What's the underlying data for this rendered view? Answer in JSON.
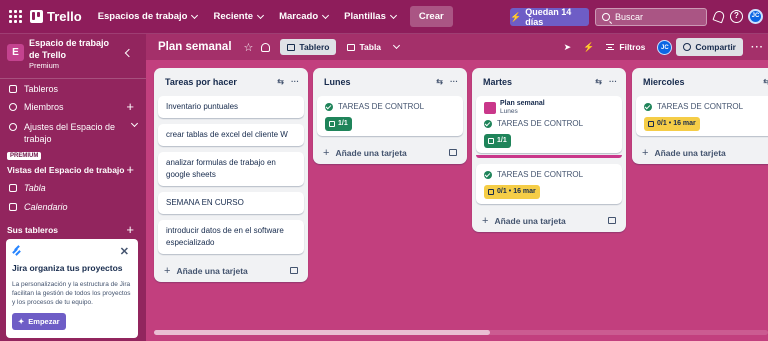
{
  "topbar": {
    "app_name": "Trello",
    "nav": [
      "Espacios de trabajo",
      "Reciente",
      "Marcado",
      "Plantillas"
    ],
    "create_label": "Crear",
    "trial_label": "Quedan 14 días",
    "search_placeholder": "Buscar",
    "help_glyph": "?",
    "avatar_initials": "JC",
    "icons": [
      "grid-icon",
      "trello-logo",
      "lightning-icon",
      "bell-icon",
      "help-icon"
    ]
  },
  "sidebar": {
    "workspace_initial": "E",
    "workspace_name": "Espacio de trabajo de Trello",
    "workspace_plan": "Premium",
    "items": [
      {
        "label": "Tableros"
      },
      {
        "label": "Miembros"
      },
      {
        "label": "Ajustes del Espacio de trabajo"
      }
    ],
    "premium_badge": "PREMIUM",
    "views_title": "Vistas del Espacio de trabajo",
    "views": [
      {
        "label": "Tabla"
      },
      {
        "label": "Calendario"
      }
    ],
    "boards_title": "Sus tableros",
    "jira": {
      "title": "Jira organiza tus proyectos",
      "body": "La personalización y la estructura de Jira facilitan la gestión de todos los proyectos y los procesos de tu equipo.",
      "button": "Empezar",
      "close": "✕"
    }
  },
  "board": {
    "title": "Plan semanal",
    "tabs": [
      {
        "label": "Tablero"
      },
      {
        "label": "Tabla"
      }
    ],
    "filters_label": "Filtros",
    "share_label": "Compartir",
    "avatar_initials": "JC",
    "more": "···",
    "add_card": "Añade una tarjeta",
    "list_actions": {
      "collapse": "⇆",
      "more": "···"
    }
  },
  "lists": [
    {
      "title": "Tareas por hacer",
      "cards": [
        "Inventario puntuales",
        "crear tablas de excel del cliente W",
        "analizar formulas de trabajo en google sheets",
        "SEMANA EN CURSO",
        "introducir datos de en el software especializado"
      ]
    },
    {
      "title": "Lunes",
      "cards": [
        {
          "title": "TAREAS DE CONTROL",
          "checklist": "1/1",
          "status": "complete"
        }
      ]
    },
    {
      "title": "Martes",
      "cards": [
        {
          "link_title": "Plan semanal",
          "link_sub": "Lunes",
          "title": "TAREAS DE CONTROL",
          "checklist": "1/1",
          "status": "complete"
        },
        {
          "title": "TAREAS DE CONTROL",
          "checklist": "0/1",
          "due": "16 mar",
          "status": "due"
        }
      ]
    },
    {
      "title": "Miercoles",
      "cards": [
        {
          "title": "TAREAS DE CONTROL",
          "checklist": "0/1",
          "due": "16 mar",
          "status": "due"
        }
      ]
    }
  ],
  "colors": {
    "topbar": "#8e1d5b",
    "sidebar": "#92255e",
    "board_bg": "#c23f7e",
    "trial_button": "#6e5dc6",
    "complete_badge": "#1f845a",
    "due_badge": "#f5cd47"
  }
}
